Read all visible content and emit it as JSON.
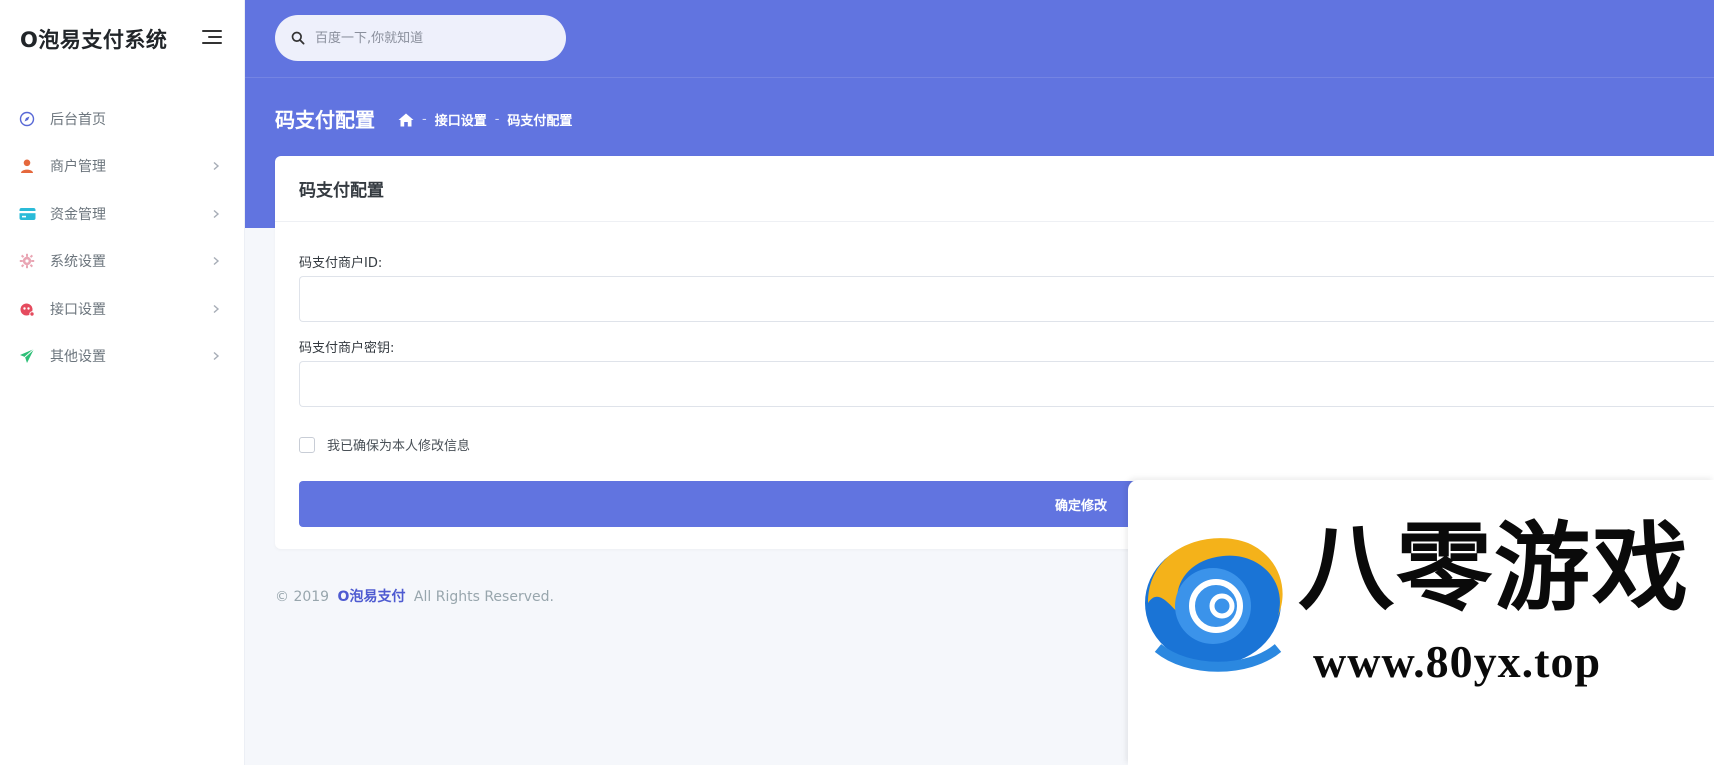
{
  "app": {
    "brand": "O泡易支付系统"
  },
  "sidebar": {
    "items": [
      {
        "label": "后台首页",
        "icon": "compass-icon",
        "color": "#5868d6",
        "has_arrow": false
      },
      {
        "label": "商户管理",
        "icon": "user-icon",
        "color": "#e5683c",
        "has_arrow": true
      },
      {
        "label": "资金管理",
        "icon": "card-icon",
        "color": "#2bbbd8",
        "has_arrow": true
      },
      {
        "label": "系统设置",
        "icon": "gear-icon",
        "color": "#e9a6b4",
        "has_arrow": true
      },
      {
        "label": "接口设置",
        "icon": "plug-icon",
        "color": "#e54b5e",
        "has_arrow": true
      },
      {
        "label": "其他设置",
        "icon": "paper-plane-icon",
        "color": "#2dbf77",
        "has_arrow": true
      }
    ]
  },
  "header": {
    "search_placeholder": "百度一下,你就知道",
    "page_title": "码支付配置",
    "breadcrumb": [
      "接口设置",
      "码支付配置"
    ],
    "accent": "#6174e0"
  },
  "card": {
    "title": "码支付配置",
    "fields": [
      {
        "label": "码支付商户ID:",
        "value": ""
      },
      {
        "label": "码支付商户密钥:",
        "value": ""
      }
    ],
    "checkbox_label": "我已确保为本人修改信息",
    "submit_label": "确定修改"
  },
  "footer": {
    "prefix": "© 2019",
    "brand": "O泡易支付",
    "suffix": "All Rights Reserved."
  },
  "watermark": {
    "title": "八零游戏",
    "url": "www.80yx.top"
  }
}
